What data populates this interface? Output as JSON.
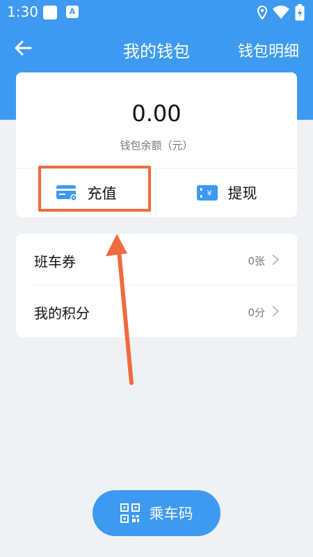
{
  "status_bar": {
    "time": "1:30",
    "app_badge": "A"
  },
  "nav": {
    "title": "我的钱包",
    "right_action": "钱包明细"
  },
  "wallet": {
    "balance": "0.00",
    "balance_label": "钱包余额（元）",
    "actions": [
      {
        "label": "充值",
        "icon": "card-icon"
      },
      {
        "label": "提现",
        "icon": "withdraw-icon"
      }
    ]
  },
  "list": [
    {
      "label": "班车券",
      "value": "0张"
    },
    {
      "label": "我的积分",
      "value": "0分"
    }
  ],
  "ride_button": {
    "label": "乘车码",
    "icon": "qr-code-icon"
  },
  "colors": {
    "primary": "#3d9af0",
    "highlight": "#f06a3e",
    "background": "#f0f1f5"
  }
}
